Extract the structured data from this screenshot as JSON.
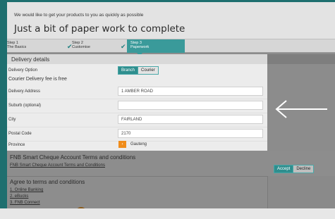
{
  "header": {
    "subtitle": "We would like to get your products to you as quickly as possible",
    "title": "Just a bit of paper work to complete"
  },
  "steps": [
    {
      "num": "Step 1",
      "name": "The Basics",
      "completed": true
    },
    {
      "num": "Step 2",
      "name": "Customise",
      "completed": true
    },
    {
      "num": "Step 3",
      "name": "Paperwork",
      "completed": false,
      "active": true
    }
  ],
  "delivery": {
    "heading": "Delivery details",
    "option_label": "Delivery Option",
    "options": [
      "Branch",
      "Courier"
    ],
    "free_note": "Courier Delivery fee is free",
    "fields": [
      {
        "label": "Delivery Address",
        "value": "1 AMBER ROAD"
      },
      {
        "label": "Suburb (optional)",
        "value": ""
      },
      {
        "label": "City",
        "value": "FAIRLAND"
      },
      {
        "label": "Postal Code",
        "value": "2170"
      }
    ],
    "province_label": "Province",
    "province_value": "Gauteng"
  },
  "terms": {
    "heading": "FNB Smart Cheque Account Terms and conditions",
    "link": "FNB Smart Cheque Account Terms and Conditions",
    "accept": "Accept",
    "decline": "Decline"
  },
  "agree": {
    "heading": "Agree to terms and conditions",
    "items": [
      "1. Online Banking",
      "2. eBucks",
      "3. FNB Connect"
    ]
  },
  "colors": {
    "accent": "#3a9a9a",
    "frame": "#1e6f6f",
    "orange": "#f08c1a"
  }
}
